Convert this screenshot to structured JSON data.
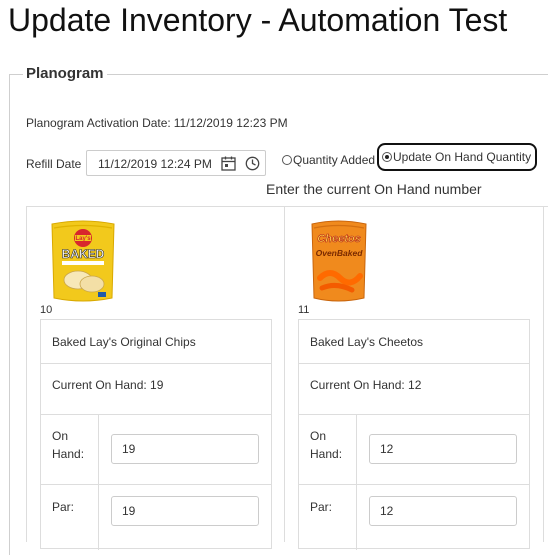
{
  "page": {
    "title": "Update Inventory - Automation Test"
  },
  "planogram": {
    "legend": "Planogram",
    "activation_label": "Planogram Activation Date:",
    "activation_value": "11/12/2019 12:23 PM",
    "refill_label": "Refill Date",
    "refill_value": "11/12/2019 12:24 PM",
    "mode_options": [
      {
        "label": "Quantity Added",
        "checked": false
      },
      {
        "label": "Update On Hand Quantity",
        "checked": true
      }
    ],
    "hint": "Enter the current On Hand number"
  },
  "products": [
    {
      "number": "10",
      "image_icon": "lays-baked-chips-bag",
      "name": "Baked Lay's Original Chips",
      "current_on_hand": "Current On Hand: 19",
      "on_hand_label": "On Hand:",
      "on_hand_value": "19",
      "par_label": "Par:",
      "par_value": "19"
    },
    {
      "number": "11",
      "image_icon": "cheetos-ovenbaked-bag",
      "name": "Baked Lay's Cheetos",
      "current_on_hand": "Current On Hand: 12",
      "on_hand_label": "On Hand:",
      "on_hand_value": "12",
      "par_label": "Par:",
      "par_value": "12"
    }
  ],
  "colors": {
    "border": "#dddddd",
    "lays_yellow": "#f2c91c",
    "cheetos_orange": "#f08a1d"
  }
}
